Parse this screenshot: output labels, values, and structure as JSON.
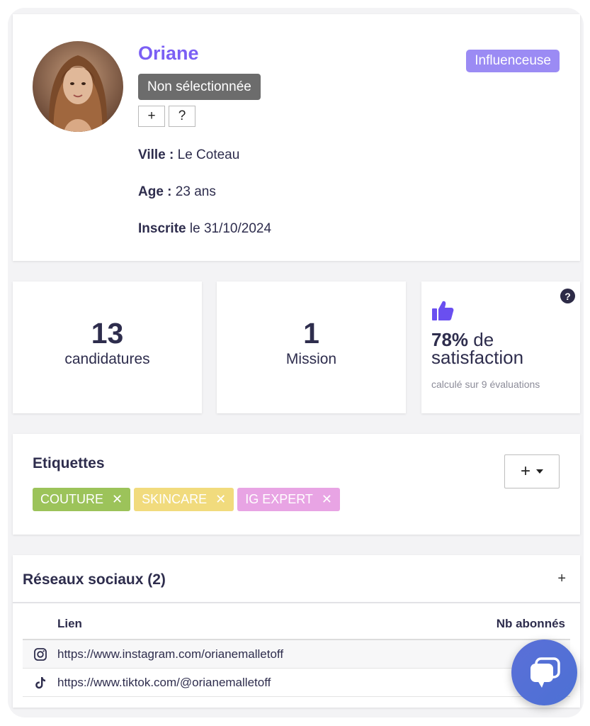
{
  "profile": {
    "name": "Oriane",
    "status": "Non sélectionnée",
    "role": "Influenceuse",
    "add_button": "+",
    "help_button": "?",
    "city_label": "Ville :",
    "city_value": "Le Coteau",
    "age_label": "Age :",
    "age_value": "23 ans",
    "joined_label": "Inscrite",
    "joined_value": "le 31/10/2024"
  },
  "stats": {
    "applications_count": "13",
    "applications_label": "candidatures",
    "missions_count": "1",
    "missions_label": "Mission",
    "satisfaction_value": "78%",
    "satisfaction_label": "de satisfaction",
    "satisfaction_sub": "calculé sur 9 évaluations",
    "help_icon": "?"
  },
  "tags": {
    "title": "Etiquettes",
    "add_button": "+",
    "items": [
      {
        "label": "COUTURE",
        "color": "#9cc35a"
      },
      {
        "label": "SKINCARE",
        "color": "#f1db7d"
      },
      {
        "label": "IG EXPERT",
        "color": "#e8a4e4"
      }
    ],
    "remove_glyph": "✕"
  },
  "social": {
    "title": "Réseaux sociaux (2)",
    "add_button": "+",
    "columns": {
      "link": "Lien",
      "followers": "Nb abonnés"
    },
    "rows": [
      {
        "icon": "instagram-icon",
        "url": "https://www.instagram.com/orianemalletoff"
      },
      {
        "icon": "tiktok-icon",
        "url": "https://www.tiktok.com/@orianemalletoff"
      }
    ]
  },
  "colors": {
    "accent": "#7b5ff4",
    "role_badge": "#9b8bf4",
    "status_badge": "#6c6c6c",
    "chat_button": "#5b6fd8"
  }
}
